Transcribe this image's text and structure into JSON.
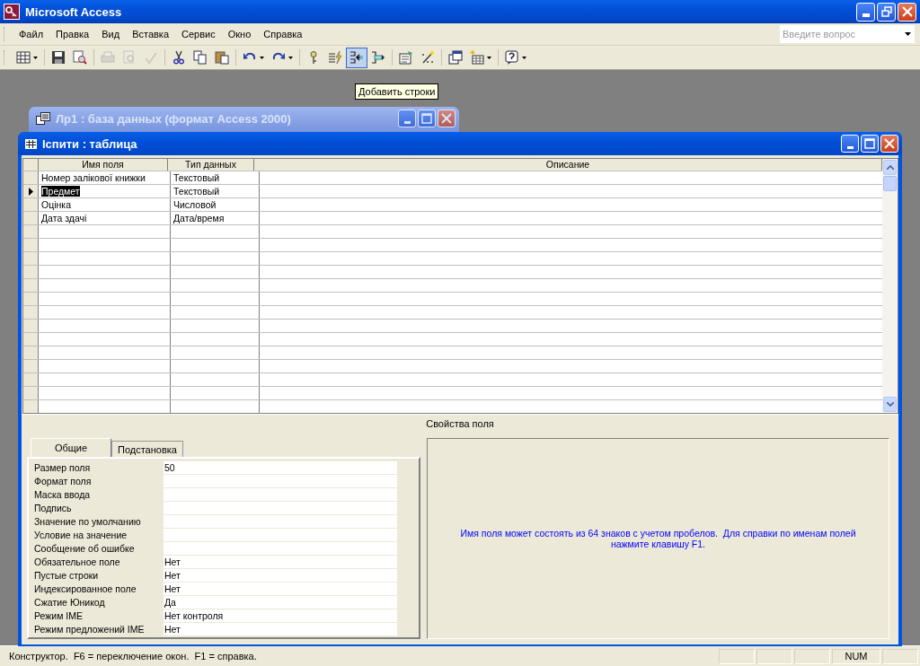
{
  "app": {
    "title": "Microsoft Access"
  },
  "menu": [
    "Файл",
    "Правка",
    "Вид",
    "Вставка",
    "Сервис",
    "Окно",
    "Справка"
  ],
  "help_box": {
    "placeholder": "Введите вопрос"
  },
  "toolbar": [
    {
      "kind": "view",
      "dropdown": true,
      "disabled": false,
      "highlighted": false
    },
    {
      "kind": "separator"
    },
    {
      "kind": "save",
      "dropdown": false,
      "disabled": false,
      "highlighted": false
    },
    {
      "kind": "search-file",
      "dropdown": false,
      "disabled": false,
      "highlighted": false
    },
    {
      "kind": "separator"
    },
    {
      "kind": "print",
      "dropdown": false,
      "disabled": true,
      "highlighted": false
    },
    {
      "kind": "print-preview",
      "dropdown": false,
      "disabled": true,
      "highlighted": false
    },
    {
      "kind": "spelling",
      "dropdown": false,
      "disabled": true,
      "highlighted": false
    },
    {
      "kind": "separator"
    },
    {
      "kind": "cut",
      "dropdown": false,
      "disabled": false,
      "highlighted": false
    },
    {
      "kind": "copy",
      "dropdown": false,
      "disabled": false,
      "highlighted": false
    },
    {
      "kind": "paste",
      "dropdown": false,
      "disabled": false,
      "highlighted": false
    },
    {
      "kind": "separator"
    },
    {
      "kind": "undo",
      "dropdown": true,
      "disabled": false,
      "highlighted": false
    },
    {
      "kind": "redo",
      "dropdown": true,
      "disabled": false,
      "highlighted": false
    },
    {
      "kind": "separator"
    },
    {
      "kind": "primary-key",
      "dropdown": false,
      "disabled": false,
      "highlighted": false
    },
    {
      "kind": "indexes",
      "dropdown": false,
      "disabled": false,
      "highlighted": false
    },
    {
      "kind": "insert-rows",
      "dropdown": false,
      "disabled": false,
      "highlighted": true
    },
    {
      "kind": "delete-rows",
      "dropdown": false,
      "disabled": false,
      "highlighted": false
    },
    {
      "kind": "separator"
    },
    {
      "kind": "properties",
      "dropdown": false,
      "disabled": false,
      "highlighted": false
    },
    {
      "kind": "build",
      "dropdown": false,
      "disabled": false,
      "highlighted": false
    },
    {
      "kind": "separator"
    },
    {
      "kind": "database-window",
      "dropdown": false,
      "disabled": false,
      "highlighted": false
    },
    {
      "kind": "new-object",
      "dropdown": true,
      "disabled": false,
      "highlighted": false
    },
    {
      "kind": "separator"
    },
    {
      "kind": "help",
      "dropdown": true,
      "disabled": false,
      "highlighted": false
    }
  ],
  "tooltip": "Добавить строки",
  "database_window": {
    "title": "Лр1 : база данных (формат Access 2000)",
    "active": false
  },
  "table_window": {
    "title": "Іспити : таблица",
    "active": true,
    "columns": [
      "Имя поля",
      "Тип данных",
      "Описание"
    ],
    "rows": [
      {
        "name": "Номер залікової книжки",
        "type": "Текстовый",
        "selected": false
      },
      {
        "name": "Предмет",
        "type": "Текстовый",
        "selected": true
      },
      {
        "name": "Оцінка",
        "type": "Числовой",
        "selected": false
      },
      {
        "name": "Дата здачі",
        "type": "Дата/время",
        "selected": false
      }
    ],
    "properties_title": "Свойства поля",
    "tabs": [
      {
        "label": "Общие",
        "selected": true
      },
      {
        "label": "Подстановка",
        "selected": false
      }
    ],
    "properties": [
      {
        "label": "Размер поля",
        "value": "50"
      },
      {
        "label": "Формат поля"
      },
      {
        "label": "Маска ввода"
      },
      {
        "label": "Подпись"
      },
      {
        "label": "Значение по умолчанию"
      },
      {
        "label": "Условие на значение"
      },
      {
        "label": "Сообщение об ошибке"
      },
      {
        "label": "Обязательное поле",
        "value": "Нет"
      },
      {
        "label": "Пустые строки",
        "value": "Нет"
      },
      {
        "label": "Индексированное поле",
        "value": "Нет"
      },
      {
        "label": "Сжатие Юникод",
        "value": "Да"
      },
      {
        "label": "Режим IME",
        "value": "Нет контроля"
      },
      {
        "label": "Режим предложений IME",
        "value": "Нет"
      }
    ],
    "hint": "Имя поля может состоять из 64 знаков с учетом пробелов.  Для справки по именам полей нажмите клавишу F1."
  },
  "status_bar": {
    "text": "Конструктор.  F6 = переключение окон.  F1 = справка.",
    "indicator": "NUM"
  }
}
